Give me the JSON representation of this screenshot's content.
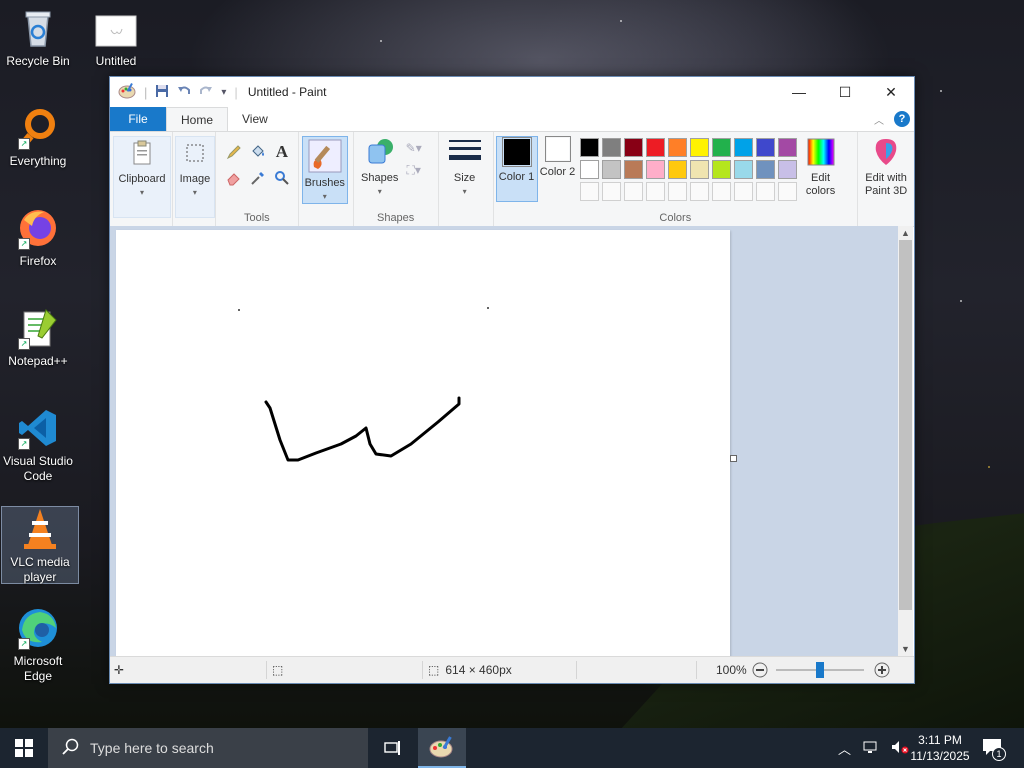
{
  "desktop": {
    "icons": [
      {
        "label": "Recycle Bin"
      },
      {
        "label": "Untitled"
      },
      {
        "label": "Everything"
      },
      {
        "label": "Firefox"
      },
      {
        "label": "Notepad++"
      },
      {
        "label": "Visual Studio Code"
      },
      {
        "label": "VLC media player"
      },
      {
        "label": "Microsoft Edge"
      }
    ]
  },
  "paint": {
    "title": "Untitled - Paint",
    "tabs": {
      "file": "File",
      "home": "Home",
      "view": "View"
    },
    "ribbon": {
      "clipboard": "Clipboard",
      "image": "Image",
      "tools_group": "Tools",
      "brushes": "Brushes",
      "shapes": "Shapes",
      "shapes_group": "Shapes",
      "size": "Size",
      "color1": "Color 1",
      "color2": "Color 2",
      "colors_group": "Colors",
      "edit_colors": "Edit colors",
      "edit_paint3d": "Edit with Paint 3D"
    },
    "palette_row1": [
      "#000000",
      "#7f7f7f",
      "#880015",
      "#ed1c24",
      "#ff7f27",
      "#fff200",
      "#22b14c",
      "#00a2e8",
      "#3f48cc",
      "#a349a4"
    ],
    "palette_row2": [
      "#ffffff",
      "#c3c3c3",
      "#b97a57",
      "#ffaec9",
      "#ffc90e",
      "#efe4b0",
      "#b5e61d",
      "#99d9ea",
      "#7092be",
      "#c8bfe7"
    ],
    "color1_value": "#000000",
    "color2_value": "#ffffff",
    "status": {
      "canvas_size": "614 × 460px",
      "zoom": "100%"
    }
  },
  "taskbar": {
    "search_placeholder": "Type here to search",
    "time": "3:11 PM",
    "date": "11/13/2025",
    "notification_count": "1"
  }
}
